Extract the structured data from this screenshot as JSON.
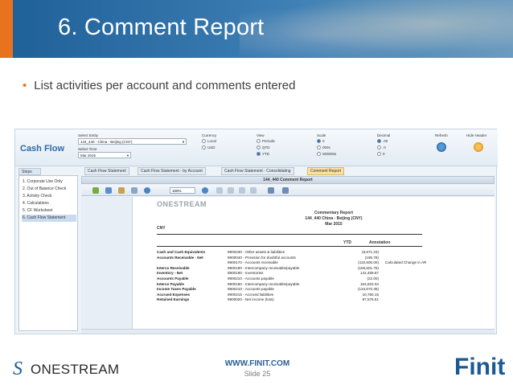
{
  "slide": {
    "title": "6.  Comment Report",
    "bullet": "List activities per account and comments entered",
    "footer_url": "WWW.FINIT.COM",
    "slide_number": "Slide 25",
    "footer_logo_text": "ONESTREAM",
    "brand_logo_text": "Finit"
  },
  "colors": {
    "accent": "#e8731e",
    "brand_blue": "#1f5c96",
    "active_tab": "#fbe3a8"
  },
  "app": {
    "name": "Cash Flow",
    "select_entity_label": "Select Entity",
    "select_entity_value": "144_440 - China - Beijing (CNY)",
    "select_time_label": "Select Time",
    "select_time_value": "Mar 2015",
    "currency_label": "Currency",
    "currency_options": [
      "Local",
      "USD"
    ],
    "view_label": "View",
    "view_options": [
      "Periodic",
      "QTD",
      "YTD"
    ],
    "scale_label": "Scale",
    "scale_options": [
      "0",
      "000s",
      "000000s"
    ],
    "decimal_label": "Decimal",
    "decimal_options": [
      ".00",
      ".0",
      "0"
    ],
    "refresh_label": "Refresh",
    "hide_header_label": "Hide Header",
    "steps_tab": "Steps",
    "steps": [
      "1. Corporate Use Only",
      "2. Out of Balance Check",
      "3. Activity Check",
      "4. Calculations",
      "5. CF Worksheet",
      "6. Cash Flow Statement"
    ],
    "tabs": [
      "Cash Flow Statement",
      "Cash Flow Statement - by Account",
      "Cash Flow Statement - Consolidating",
      "Comment Report"
    ],
    "report_title": "144_440 Comment Report",
    "zoom": "100%"
  },
  "report": {
    "logo": "ONESTREAM",
    "heading": "Commentary Report",
    "entity": "144_440 China - Beijing (CNY)",
    "period": "Mar 2015",
    "currency": "CNY",
    "col_ytd": "YTD",
    "col_annotation": "Annotation",
    "rows": [
      {
        "account": "Cash and Cash Equivalents",
        "code": "9900230 - Other assets & liabilities",
        "ytd": "(6,871.23)",
        "annotation": ""
      },
      {
        "account": "Accounts Receivable - Net",
        "code": "9900040 - Provision for doubtful accounts",
        "ytd": "(195.78)",
        "annotation": ""
      },
      {
        "account": "",
        "code": "9900170 - Accounts receivable",
        "ytd": "(110,500.00)",
        "annotation": "Calculated Change in AR"
      },
      {
        "account": "Interco Receivable",
        "code": "9900180 - Intercompany receivable/payable",
        "ytd": "(155,501.75)",
        "annotation": ""
      },
      {
        "account": "Inventory - Net",
        "code": "9900190 - Inventories",
        "ytd": "142,459.87",
        "annotation": ""
      },
      {
        "account": "Accounts Payable",
        "code": "9900210 - Accounts payable",
        "ytd": "(22.00)",
        "annotation": ""
      },
      {
        "account": "Interco Payable",
        "code": "9900180 - Intercompany receivable/payable",
        "ytd": "154,822.04",
        "annotation": ""
      },
      {
        "account": "Income Taxes Payable",
        "code": "9900210 - Accounts payable",
        "ytd": "(134,670.36)",
        "annotation": ""
      },
      {
        "account": "Accrued Expenses",
        "code": "9900215 - Accrued liabilities",
        "ytd": "10,760.15",
        "annotation": ""
      },
      {
        "account": "Retained Earnings",
        "code": "9900020 - Net income (loss)",
        "ytd": "87,576.61",
        "annotation": ""
      }
    ]
  }
}
